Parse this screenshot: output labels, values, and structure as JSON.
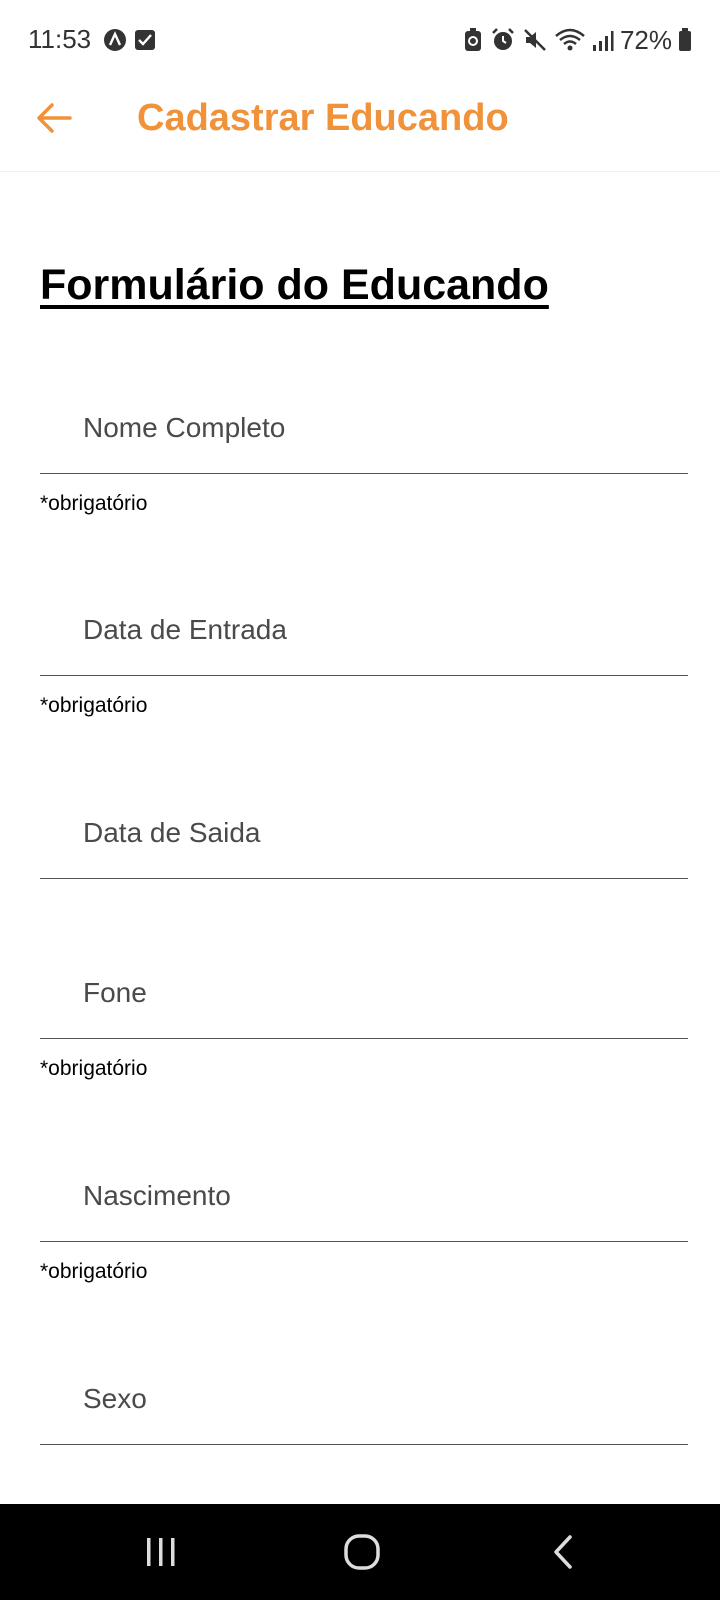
{
  "status_bar": {
    "time": "11:53",
    "battery_text": "72%",
    "icons": [
      "a-app-icon",
      "checkbox-icon",
      "battery-saver-icon",
      "alarm-icon",
      "mute-icon",
      "wifi-icon",
      "signal-icon",
      "battery-icon"
    ]
  },
  "app_bar": {
    "title": "Cadastrar Educando",
    "accent_color": "#F0923A"
  },
  "form": {
    "heading": "Formulário do Educando",
    "fields": [
      {
        "label": "Nome Completo",
        "required_note": "*obrigatório"
      },
      {
        "label": "Data de Entrada",
        "required_note": "*obrigatório"
      },
      {
        "label": "Data de Saida",
        "required_note": ""
      },
      {
        "label": "Fone",
        "required_note": "*obrigatório"
      },
      {
        "label": "Nascimento",
        "required_note": "*obrigatório"
      },
      {
        "label": "Sexo",
        "required_note": ""
      }
    ]
  },
  "nav_bar": {
    "buttons": [
      "recent-apps-icon",
      "home-icon",
      "back-icon"
    ]
  }
}
